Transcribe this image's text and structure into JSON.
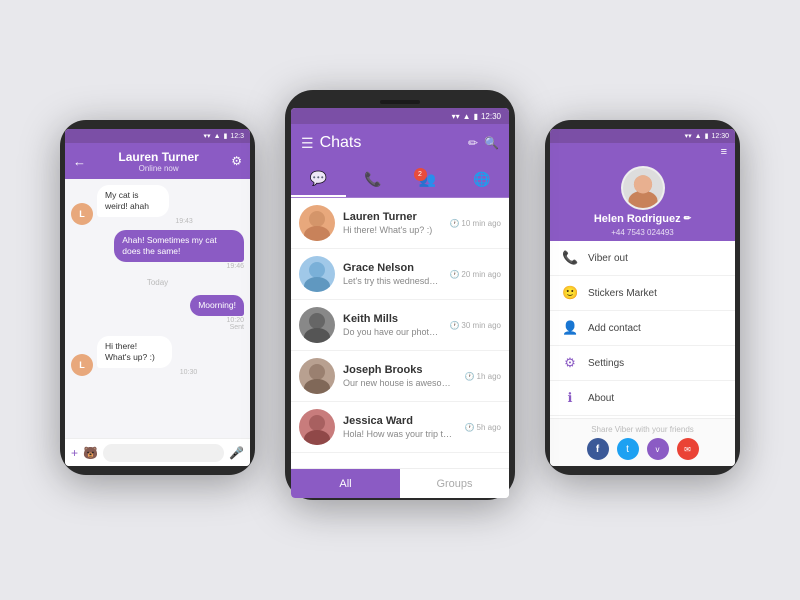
{
  "center_phone": {
    "status_bar": {
      "time": "12:30"
    },
    "header": {
      "menu_label": "☰",
      "title": "Chats",
      "edit_label": "✏",
      "search_label": "🔍"
    },
    "tabs": [
      {
        "icon": "💬",
        "active": true,
        "badge": null
      },
      {
        "icon": "📞",
        "active": false,
        "badge": null
      },
      {
        "icon": "👥",
        "active": false,
        "badge": "2"
      },
      {
        "icon": "🌐",
        "active": false,
        "badge": null
      }
    ],
    "chats": [
      {
        "name": "Lauren Turner",
        "preview": "Hi there! What's up? :)",
        "time": "10 min ago",
        "avatar_color": "#e8a87c"
      },
      {
        "name": "Grace Nelson",
        "preview": "Let's try this wednesday... Is that alright? :)",
        "time": "20 min ago",
        "avatar_color": "#a0c8e8"
      },
      {
        "name": "Keith Mills",
        "preview": "Do you have our photos from the nye?",
        "time": "30 min ago",
        "avatar_color": "#888"
      },
      {
        "name": "Joseph Brooks",
        "preview": "Our new house is awesome! You should come over to have a look :)",
        "time": "1h ago",
        "avatar_color": "#b8a090"
      },
      {
        "name": "Jessica Ward",
        "preview": "Hola! How was your trip to Dominican Republic? OMG So jealous!!",
        "time": "5h ago",
        "avatar_color": "#c87c7c"
      }
    ],
    "bottom_tabs": [
      {
        "label": "All",
        "active": true
      },
      {
        "label": "Groups",
        "active": false
      }
    ]
  },
  "left_phone": {
    "status_bar": {
      "time": "12:3"
    },
    "header": {
      "back_label": "←",
      "name": "Lauren Turner",
      "sub": "Online now",
      "settings_label": "⚙"
    },
    "messages": [
      {
        "text": "My cat is weird! ahah",
        "time": "19:43",
        "type": "in"
      },
      {
        "text": "Ahah! Sometimes my cat does the same!",
        "time": "19:46",
        "type": "out"
      },
      {
        "divider": "Today"
      },
      {
        "text": "Moorning!",
        "time": "10:20",
        "type": "out",
        "sent": "Sent"
      },
      {
        "text": "Hi there! What's up? :)",
        "time": "10:30",
        "type": "in"
      }
    ],
    "input_placeholder": ""
  },
  "right_phone": {
    "status_bar": {
      "time": "12:30"
    },
    "header": {
      "menu_label": "≡"
    },
    "profile": {
      "name": "Helen Rodriguez",
      "phone": "+44 7543 024493",
      "edit_icon": "✏"
    },
    "menu_items": [
      {
        "icon": "📞",
        "label": "Viber out"
      },
      {
        "icon": "🙂",
        "label": "Stickers Market"
      },
      {
        "icon": "👤",
        "label": "Add contact"
      },
      {
        "icon": "⚙",
        "label": "Settings"
      },
      {
        "icon": "ℹ",
        "label": "About"
      }
    ],
    "share": {
      "label": "Share Viber with your friends",
      "icons": [
        {
          "color": "#3b5998",
          "symbol": "f",
          "name": "facebook"
        },
        {
          "color": "#1da1f2",
          "symbol": "t",
          "name": "twitter"
        },
        {
          "color": "#8b5bc4",
          "symbol": "v",
          "name": "viber"
        },
        {
          "color": "#ea4335",
          "symbol": "✉",
          "name": "email"
        }
      ]
    }
  }
}
